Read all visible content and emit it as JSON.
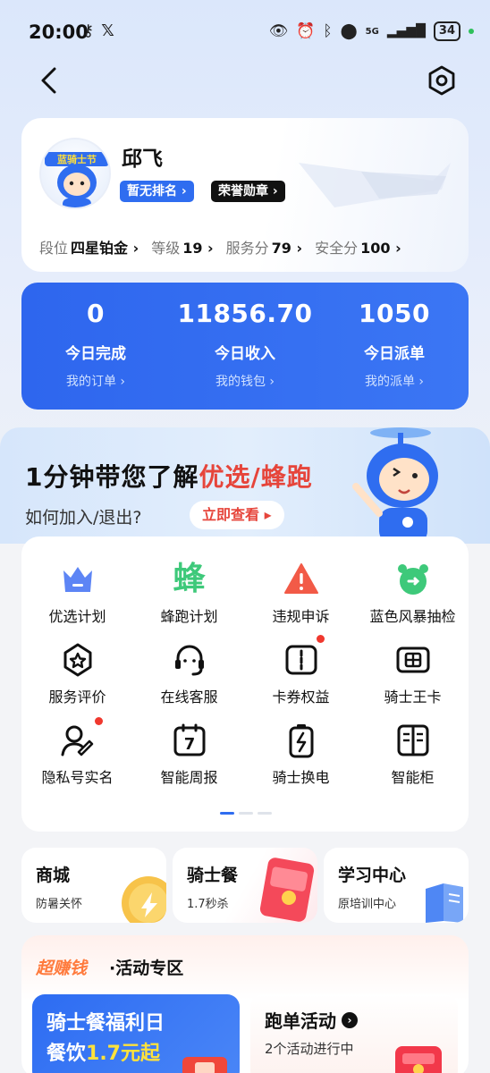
{
  "status_bar": {
    "time": "20:00",
    "battery": "34",
    "network": "5G"
  },
  "nav": {
    "back_icon": "chevron-left-icon",
    "settings_icon": "hexagon-gear-icon"
  },
  "profile": {
    "name": "邱飞",
    "avatar_banner": "蓝骑士节",
    "rank_badge": "暂无排名 ›",
    "honor_badge": "荣誉勋章 ›",
    "stats": [
      {
        "label": "段位",
        "value": "四星铂金 ›"
      },
      {
        "label": "等级",
        "value": "19 ›"
      },
      {
        "label": "服务分",
        "value": "79 ›"
      },
      {
        "label": "安全分",
        "value": "100 ›"
      }
    ]
  },
  "summary": {
    "items": [
      {
        "value": "0",
        "label": "今日完成",
        "link": "我的订单 ›"
      },
      {
        "value": "11856.70",
        "label": "今日收入",
        "link": "我的钱包 ›"
      },
      {
        "value": "1050",
        "label": "今日派单",
        "link": "我的派单 ›"
      }
    ],
    "colors": {
      "bg": "#2e66ee",
      "link": "#cfe0ff"
    }
  },
  "banner": {
    "title_prefix": "1分钟带您了解",
    "title_highlight": "优选/蜂跑",
    "subtitle": "如何加入/退出?",
    "button": "立即查看 ▸",
    "highlight_color": "#e6453b"
  },
  "grid": {
    "items": [
      {
        "label": "优选计划",
        "icon": "crown-icon"
      },
      {
        "label": "蜂跑计划",
        "icon": "bee-character-icon",
        "glyph": "蜂"
      },
      {
        "label": "违规申诉",
        "icon": "warning-triangle-icon"
      },
      {
        "label": "蓝色风暴抽检",
        "icon": "alarm-clock-icon"
      },
      {
        "label": "服务评价",
        "icon": "star-badge-icon"
      },
      {
        "label": "在线客服",
        "icon": "headset-icon"
      },
      {
        "label": "卡券权益",
        "icon": "coupon-icon"
      },
      {
        "label": "骑士王卡",
        "icon": "sim-card-icon"
      },
      {
        "label": "隐私号实名",
        "icon": "user-edit-icon"
      },
      {
        "label": "智能周报",
        "icon": "calendar-icon",
        "glyph": "7"
      },
      {
        "label": "骑士换电",
        "icon": "battery-swap-icon"
      },
      {
        "label": "智能柜",
        "icon": "locker-icon"
      }
    ],
    "pager": {
      "pages": 3,
      "active": 0
    }
  },
  "mini_cards": [
    {
      "title": "商城",
      "sub": "防暑关怀"
    },
    {
      "title": "骑士餐",
      "sub": "1.7秒杀"
    },
    {
      "title": "学习中心",
      "sub": "原培训中心"
    }
  ],
  "activity": {
    "hot": "超赚钱",
    "zone": "·活动专区",
    "left_title": "骑士餐福利日",
    "left_sub_prefix": "餐饮",
    "left_sub_highlight": "1.7元起",
    "right_title": "跑单活动",
    "right_arrow": "›",
    "right_sub": "2个活动进行中"
  }
}
